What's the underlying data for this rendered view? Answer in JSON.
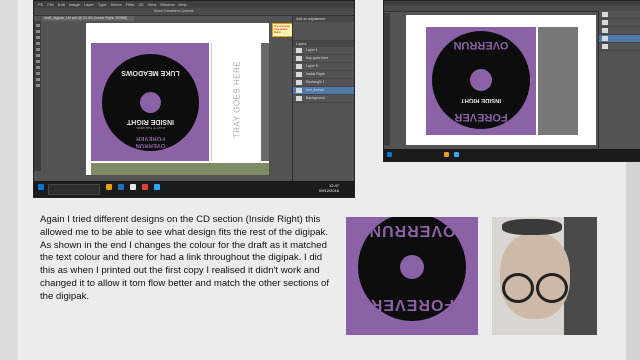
{
  "app_title": "draft_digipak_LM.psd @ 33.3% (Inside Right, RGB/8)",
  "menu": [
    "PS",
    "File",
    "Edit",
    "Image",
    "Layer",
    "Type",
    "Select",
    "Filter",
    "3D",
    "View",
    "Window",
    "Help"
  ],
  "show_transform_controls": "Show Transform Controls",
  "panels": {
    "adjustments_title": "Add an adjustment",
    "layers_header": "Layers",
    "layers": [
      "Layer 1",
      "tray goes here",
      "Layer 5",
      "Inside Right",
      "Rectangle 1",
      "text_forever",
      "Background"
    ]
  },
  "tooltip_text": "The computer says please flatten",
  "disc_design": {
    "luke": "LUKE MEADOWS",
    "inside_right": "INSIDE RIGHT",
    "forever": "FOREVER",
    "overrun": "OVERRUN",
    "tray": "TRAY GOES HERE",
    "fine_print": "0 ALT 'X' THA 'ANOS"
  },
  "photo_text": {
    "forever": "FOREVER",
    "overrun": "OVERRUN"
  },
  "taskbar": {
    "time": "12:47",
    "date": "09/12/2016"
  },
  "description": "Again I tried different designs on the CD section (Inside Right) this allowed me to be able to see what design fits the rest of the digipak. As shown in the end I changes the colour for the draft as it matched the text colour and there for had a link throughout the digipak. I did this as when I printed out the first copy I realised it didn't work and changed it to allow it tom flow better and match the other sections of the digipak."
}
